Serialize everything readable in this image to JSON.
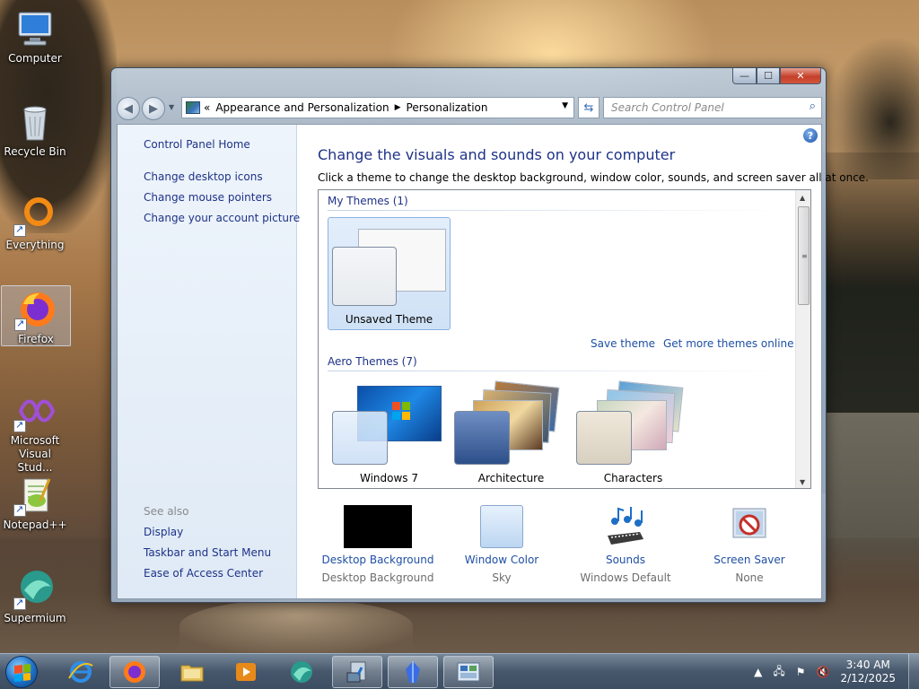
{
  "desktop": {
    "icons": [
      {
        "label": "Computer"
      },
      {
        "label": "Recycle Bin"
      },
      {
        "label": "Everything"
      },
      {
        "label": "Firefox"
      },
      {
        "label": "Microsoft Visual Stud..."
      },
      {
        "label": "Notepad++"
      },
      {
        "label": "Supermium"
      }
    ]
  },
  "window": {
    "caption": {
      "min": "—",
      "max": "☐",
      "close": "✕"
    },
    "nav": {
      "back": "◀",
      "forward": "▶"
    },
    "address": {
      "lead": "«",
      "crumbs": [
        "Appearance and Personalization",
        "Personalization"
      ],
      "sep": "▶"
    },
    "search": {
      "placeholder": "Search Control Panel"
    },
    "left_pane": {
      "home": "Control Panel Home",
      "links": [
        "Change desktop icons",
        "Change mouse pointers",
        "Change your account picture"
      ],
      "see_also_title": "See also",
      "see_also": [
        "Display",
        "Taskbar and Start Menu",
        "Ease of Access Center"
      ]
    },
    "main": {
      "title": "Change the visuals and sounds on your computer",
      "subtitle": "Click a theme to change the desktop background, window color, sounds, and screen saver all at once.",
      "my_themes_label": "My Themes (1)",
      "my_themes": [
        {
          "name": "Unsaved Theme",
          "selected": true
        }
      ],
      "save_theme": "Save theme",
      "get_more": "Get more themes online",
      "aero_label": "Aero Themes (7)",
      "aero_themes": [
        {
          "name": "Windows 7"
        },
        {
          "name": "Architecture"
        },
        {
          "name": "Characters"
        }
      ]
    },
    "bottom": [
      {
        "link": "Desktop Background",
        "value": "Desktop Background",
        "color": "#000000"
      },
      {
        "link": "Window Color",
        "value": "Sky",
        "color": "#cfe3f7"
      },
      {
        "link": "Sounds",
        "value": "Windows Default"
      },
      {
        "link": "Screen Saver",
        "value": "None"
      }
    ]
  },
  "taskbar": {
    "clock_time": "3:40 AM",
    "clock_date": "2/12/2025"
  }
}
